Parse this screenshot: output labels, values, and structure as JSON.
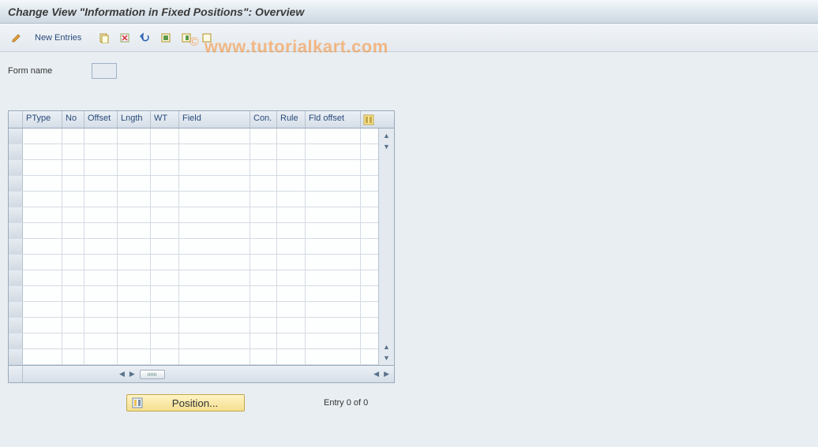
{
  "title": "Change View \"Information in Fixed Positions\": Overview",
  "toolbar": {
    "new_entries_label": "New Entries"
  },
  "form": {
    "name_label": "Form name",
    "name_value": ""
  },
  "watermark": {
    "copyright": "©",
    "text": "www.tutorialkart.com"
  },
  "table": {
    "columns": {
      "ptype": "PType",
      "no": "No",
      "offset": "Offset",
      "length": "Lngth",
      "wt": "WT",
      "field": "Field",
      "con": "Con.",
      "rule": "Rule",
      "fld_offset": "Fld offset"
    },
    "row_count": 15
  },
  "footer": {
    "position_label": "Position...",
    "entry_status": "Entry 0 of 0"
  }
}
